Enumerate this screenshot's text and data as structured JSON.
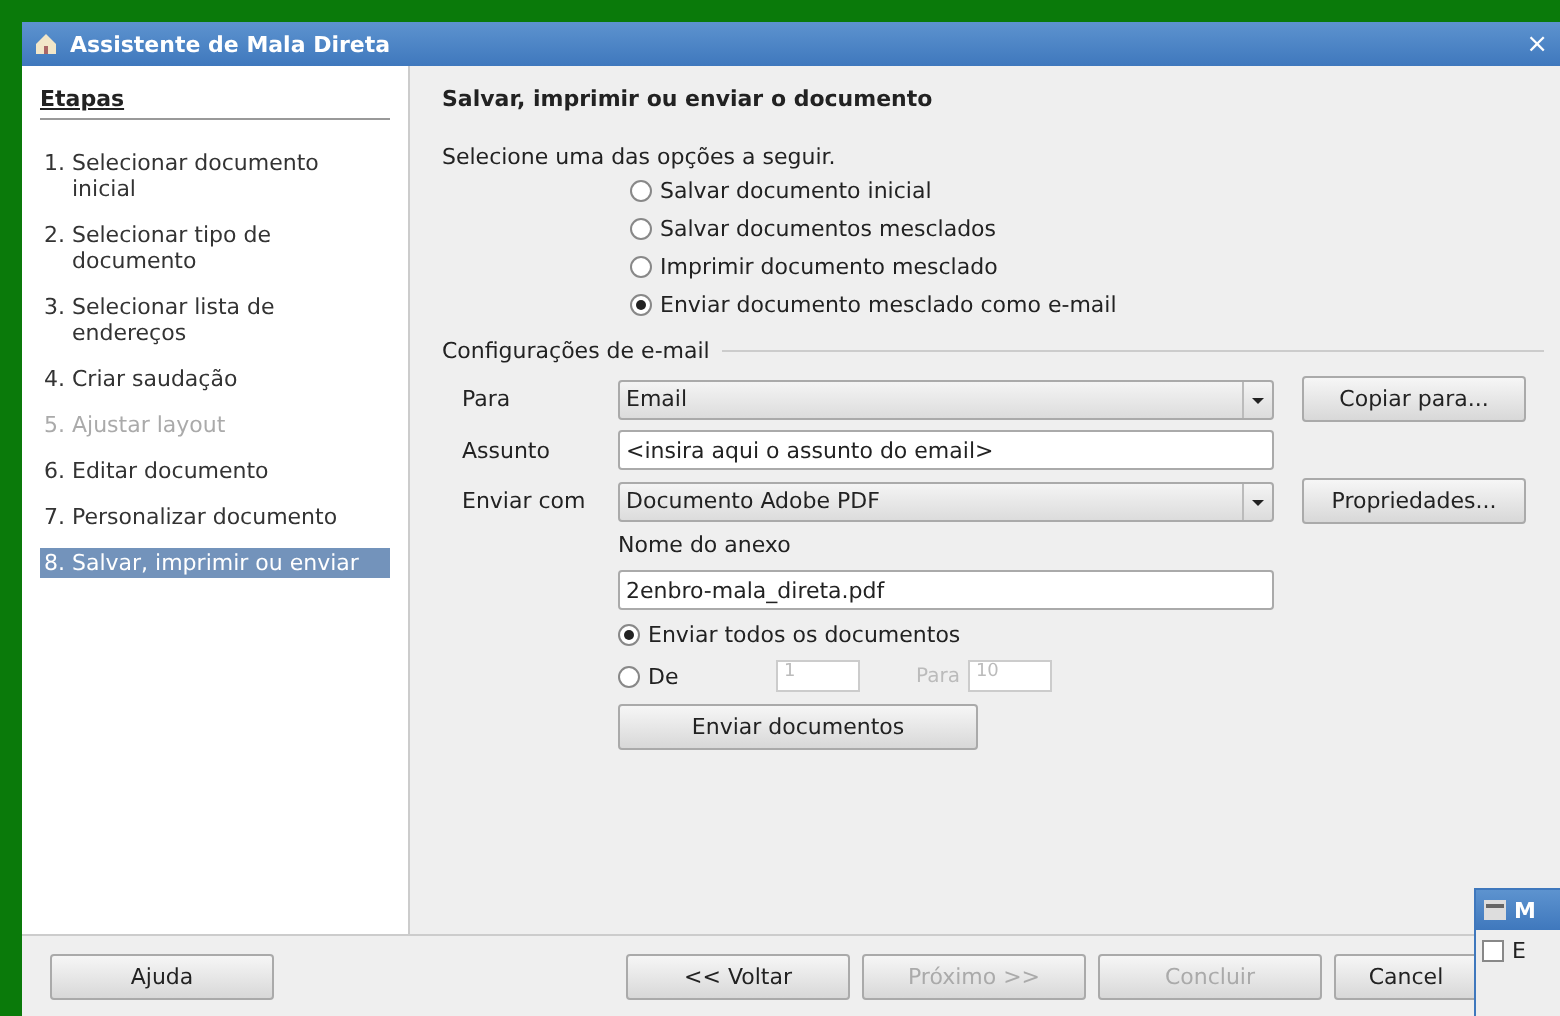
{
  "window": {
    "title": "Assistente de Mala Direta",
    "close": "×"
  },
  "steps": {
    "heading": "Etapas",
    "items": [
      {
        "label": "1. Selecionar documento inicial",
        "selected": false,
        "disabled": false
      },
      {
        "label": "2. Selecionar tipo de documento",
        "selected": false,
        "disabled": false
      },
      {
        "label": "3. Selecionar lista de endereços",
        "selected": false,
        "disabled": false
      },
      {
        "label": "4. Criar saudação",
        "selected": false,
        "disabled": false
      },
      {
        "label": "5. Ajustar layout",
        "selected": false,
        "disabled": true
      },
      {
        "label": "6. Editar documento",
        "selected": false,
        "disabled": false
      },
      {
        "label": "7. Personalizar documento",
        "selected": false,
        "disabled": false
      },
      {
        "label": "8. Salvar, imprimir ou enviar",
        "selected": true,
        "disabled": false
      }
    ]
  },
  "page": {
    "title": "Salvar, imprimir ou enviar o documento",
    "prompt": "Selecione uma das opções a seguir.",
    "options": [
      {
        "label": "Salvar documento inicial",
        "selected": false
      },
      {
        "label": "Salvar documentos mesclados",
        "selected": false
      },
      {
        "label": "Imprimir documento mesclado",
        "selected": false
      },
      {
        "label": "Enviar documento mesclado como e-mail",
        "selected": true
      }
    ],
    "email": {
      "legend": "Configurações de e-mail",
      "to": {
        "label": "Para",
        "value": "Email",
        "button": "Copiar para..."
      },
      "subject": {
        "label": "Assunto",
        "value": "<insira aqui o assunto do email>"
      },
      "send_as": {
        "label": "Enviar com",
        "value": "Documento Adobe PDF",
        "button": "Propriedades..."
      },
      "attachment": {
        "label": "Nome do anexo",
        "value": "2enbro-mala_direta.pdf"
      },
      "range": [
        {
          "kind": "all",
          "label": "Enviar todos os documentos",
          "selected": true
        },
        {
          "kind": "range",
          "label": "De",
          "selected": false,
          "from": "1",
          "to_label": "Para",
          "to": "10"
        }
      ],
      "send_button": "Enviar documentos"
    }
  },
  "footer": {
    "help": "Ajuda",
    "buttons": [
      {
        "label": "<< Voltar",
        "disabled": false
      },
      {
        "label": "Próximo >>",
        "disabled": true
      },
      {
        "label": "Concluir",
        "disabled": true
      },
      {
        "label": "Cancel",
        "disabled": false
      }
    ]
  },
  "overlay": {
    "title": "M",
    "checkbox": {
      "label": "E",
      "checked": false
    }
  }
}
